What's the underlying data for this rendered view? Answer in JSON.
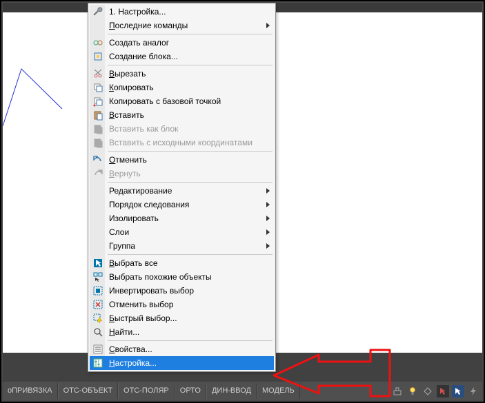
{
  "menu": {
    "item_1": "1. Настройка...",
    "recent": "Последние команды",
    "create_analog": "Создать аналог",
    "create_block": "Создание блока...",
    "cut": "Вырезать",
    "copy": "Копировать",
    "copy_base": "Копировать с базовой точкой",
    "paste": "Вставить",
    "paste_block": "Вставить как блок",
    "paste_orig": "Вставить с исходными координатами",
    "undo": "Отменить",
    "redo": "Вернуть",
    "edit": "Редактирование",
    "order": "Порядок следования",
    "isolate": "Изолировать",
    "layers": "Слои",
    "group": "Группа",
    "select_all": "Выбрать все",
    "select_similar": "Выбрать похожие объекты",
    "invert_sel": "Инвертировать выбор",
    "cancel_sel": "Отменить выбор",
    "quick_sel": "Быстрый выбор...",
    "find": "Найти...",
    "props": "Свойства...",
    "settings": "Настройка..."
  },
  "underline": {
    "recent": "П",
    "cut": "В",
    "copy": "К",
    "paste": "В",
    "undo": "О",
    "redo": "В",
    "select_all": "В",
    "quick_sel": "Б",
    "find": "Н",
    "props": "С",
    "settings": "Н"
  },
  "status": {
    "items": [
      "оПРИВЯЗКА",
      "ОТС-ОБЪЕКТ",
      "ОТС-ПОЛЯР",
      "ОРТО",
      "ДИН-ВВОД",
      "МОДЕЛЬ"
    ]
  }
}
